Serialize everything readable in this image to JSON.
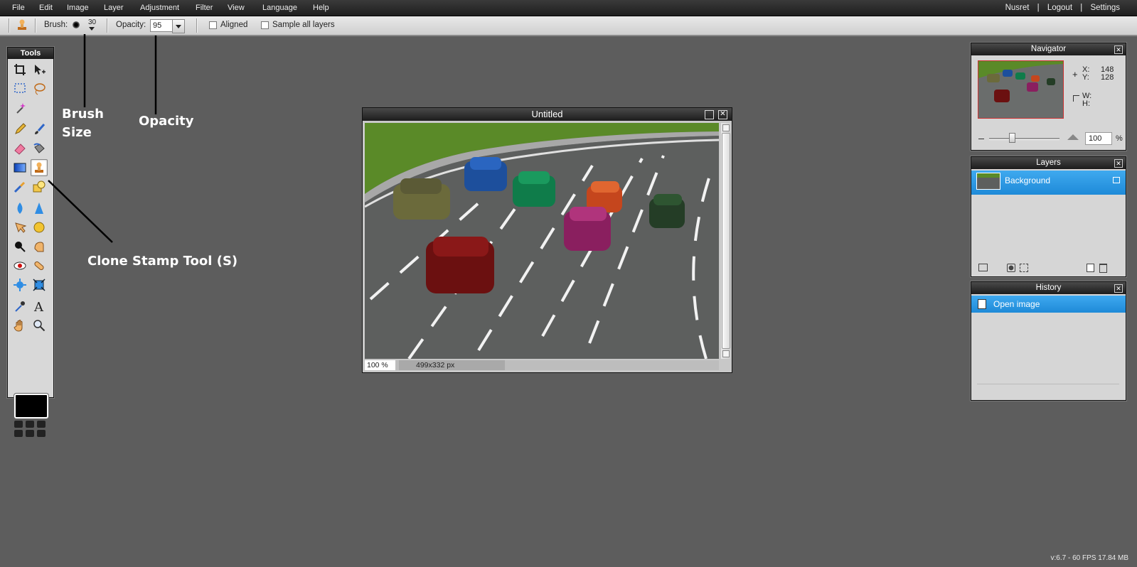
{
  "menubar": {
    "items": [
      "File",
      "Edit",
      "Image",
      "Layer",
      "Adjustment",
      "Filter",
      "View",
      "Language",
      "Help"
    ],
    "user": "Nusret",
    "separator": "|",
    "logout": "Logout",
    "settings": "Settings"
  },
  "options": {
    "brush_label": "Brush:",
    "brush_size": "30",
    "opacity_label": "Opacity:",
    "opacity_value": "95",
    "aligned_label": "Aligned",
    "aligned_checked": false,
    "sample_all_label": "Sample all layers",
    "sample_all_checked": false
  },
  "tools": {
    "title": "Tools",
    "icons": [
      "crop-icon",
      "move-icon",
      "marquee-icon",
      "lasso-icon",
      "magic-wand-icon",
      "pencil-icon",
      "brush-icon",
      "eraser-icon",
      "paint-bucket-icon",
      "gradient-icon",
      "clone-stamp-icon",
      "replace-color-icon",
      "drawing-icon",
      "blur-icon",
      "sharpen-icon",
      "smudge-icon",
      "sponge-icon",
      "dodge-icon",
      "burn-icon",
      "red-eye-icon",
      "spot-heal-icon",
      "bloat-icon",
      "pinch-icon",
      "color-picker-icon",
      "type-icon",
      "hand-icon",
      "zoom-icon"
    ],
    "selected": "clone-stamp-icon",
    "foreground_color": "#000000"
  },
  "annotations": {
    "brush_size_line1": "Brush",
    "brush_size_line2": "Size",
    "opacity": "Opacity",
    "clone_stamp": "Clone Stamp Tool (S)"
  },
  "document": {
    "title": "Untitled",
    "zoom": "100 %",
    "size": "499x332 px"
  },
  "navigator": {
    "title": "Navigator",
    "x_label": "X:",
    "x_value": "148",
    "y_label": "Y:",
    "y_value": "128",
    "w_label": "W:",
    "h_label": "H:",
    "zoom_value": "100",
    "zoom_unit": "%"
  },
  "layers": {
    "title": "Layers",
    "items": [
      {
        "name": "Background",
        "locked": true
      }
    ]
  },
  "history": {
    "title": "History",
    "items": [
      "Open image"
    ]
  },
  "footer": {
    "version": "v:6.7 - 60 FPS 17.84 MB"
  },
  "colors": {
    "accent_blue": "#2b97e3",
    "workspace": "#5d5d5d"
  }
}
